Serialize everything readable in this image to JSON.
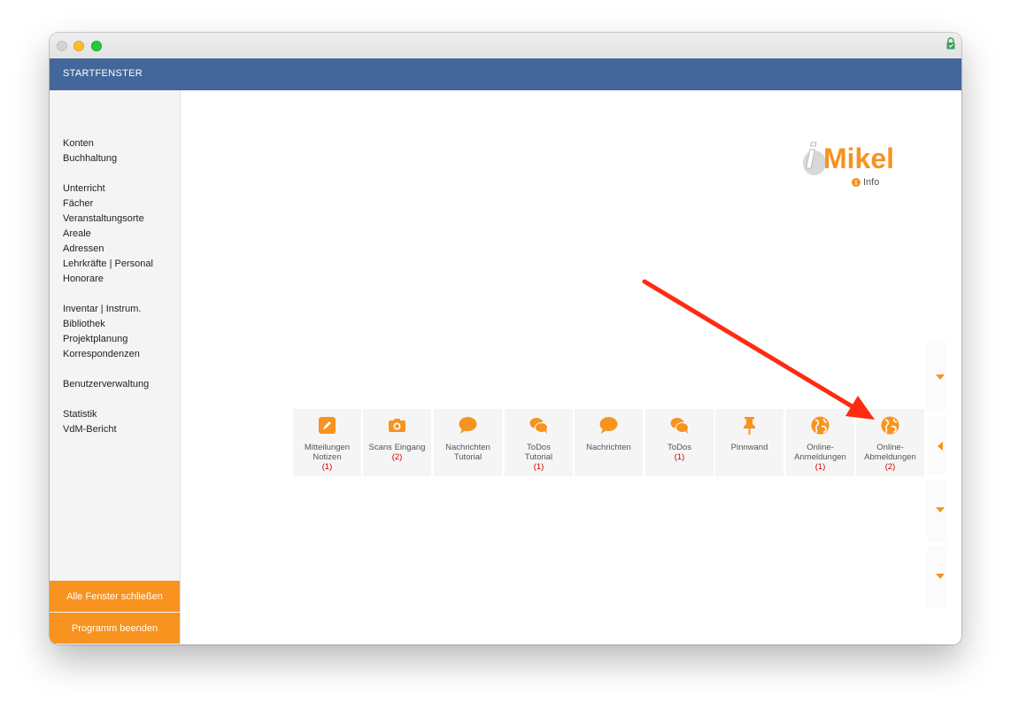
{
  "window": {
    "title": ""
  },
  "header": {
    "title": "STARTFENSTER"
  },
  "sidebar": {
    "groups": [
      [
        "Konten",
        "Buchhaltung"
      ],
      [
        "Unterricht",
        "Fächer",
        "Veranstaltungsorte",
        "Areale",
        "Adressen",
        "Lehrkräfte | Personal",
        "Honorare"
      ],
      [
        "Inventar | Instrum.",
        "Bibliothek",
        "Projektplanung",
        "Korrespondenzen"
      ],
      [
        "Benutzerverwaltung"
      ],
      [
        "Statistik",
        "VdM-Bericht"
      ]
    ],
    "close_all": "Alle Fenster schließen",
    "quit": "Programm beenden"
  },
  "logo": {
    "text_i": "i",
    "text_mikel": "Mikel"
  },
  "info": {
    "label": "Info",
    "icon": "info-icon"
  },
  "tiles": [
    {
      "line1": "Mitteilungen",
      "line2": "Notizen",
      "count": "(1)",
      "icon": "pencil-icon"
    },
    {
      "line1": "Scans Eingang",
      "line2": "",
      "count": "(2)",
      "icon": "camera-icon"
    },
    {
      "line1": "Nachrichten",
      "line2": "Tutorial",
      "count": "",
      "icon": "speech-bubble-icon"
    },
    {
      "line1": "ToDos",
      "line2": "Tutorial",
      "count": "(1)",
      "icon": "chat-bubbles-icon"
    },
    {
      "line1": "Nachrichten",
      "line2": "",
      "count": "",
      "icon": "speech-bubble-icon"
    },
    {
      "line1": "ToDos",
      "line2": "",
      "count": "(1)",
      "icon": "chat-bubbles-icon"
    },
    {
      "line1": "Pinnwand",
      "line2": "",
      "count": "",
      "icon": "pin-icon"
    },
    {
      "line1": "Online-",
      "line2": "Anmeldungen",
      "count": "(1)",
      "icon": "globe-icon"
    },
    {
      "line1": "Online-",
      "line2": "Abmeldungen",
      "count": "(2)",
      "icon": "globe-icon"
    }
  ],
  "colors": {
    "accent": "#f7931e",
    "header": "#43679a",
    "count": "#cc0000",
    "annotation": "#ff2a10"
  }
}
